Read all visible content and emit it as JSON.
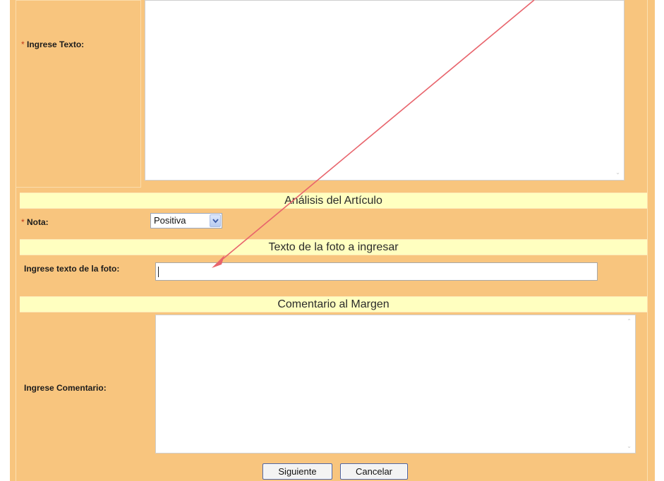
{
  "form": {
    "texto": {
      "required_mark": "*",
      "label": "Ingrese Texto:",
      "value": ""
    },
    "analisis": {
      "section_title": "Análisis del Artículo",
      "nota_required_mark": "*",
      "nota_label": "Nota:",
      "nota_selected": "Positiva"
    },
    "foto": {
      "section_title": "Texto de la foto a ingresar",
      "label": "Ingrese texto de la foto:",
      "value": ""
    },
    "comentario": {
      "section_title": "Comentario al Margen",
      "label": "Ingrese Comentario:",
      "value": ""
    },
    "buttons": {
      "next": "Siguiente",
      "cancel": "Cancelar"
    }
  },
  "colors": {
    "form_background": "#f8c57e",
    "section_header_background": "#ffffc0",
    "annotation_arrow": "#e8646c"
  },
  "icons": {
    "select_dropdown": "chevron-down-icon",
    "annotation": "arrow-annotation"
  }
}
